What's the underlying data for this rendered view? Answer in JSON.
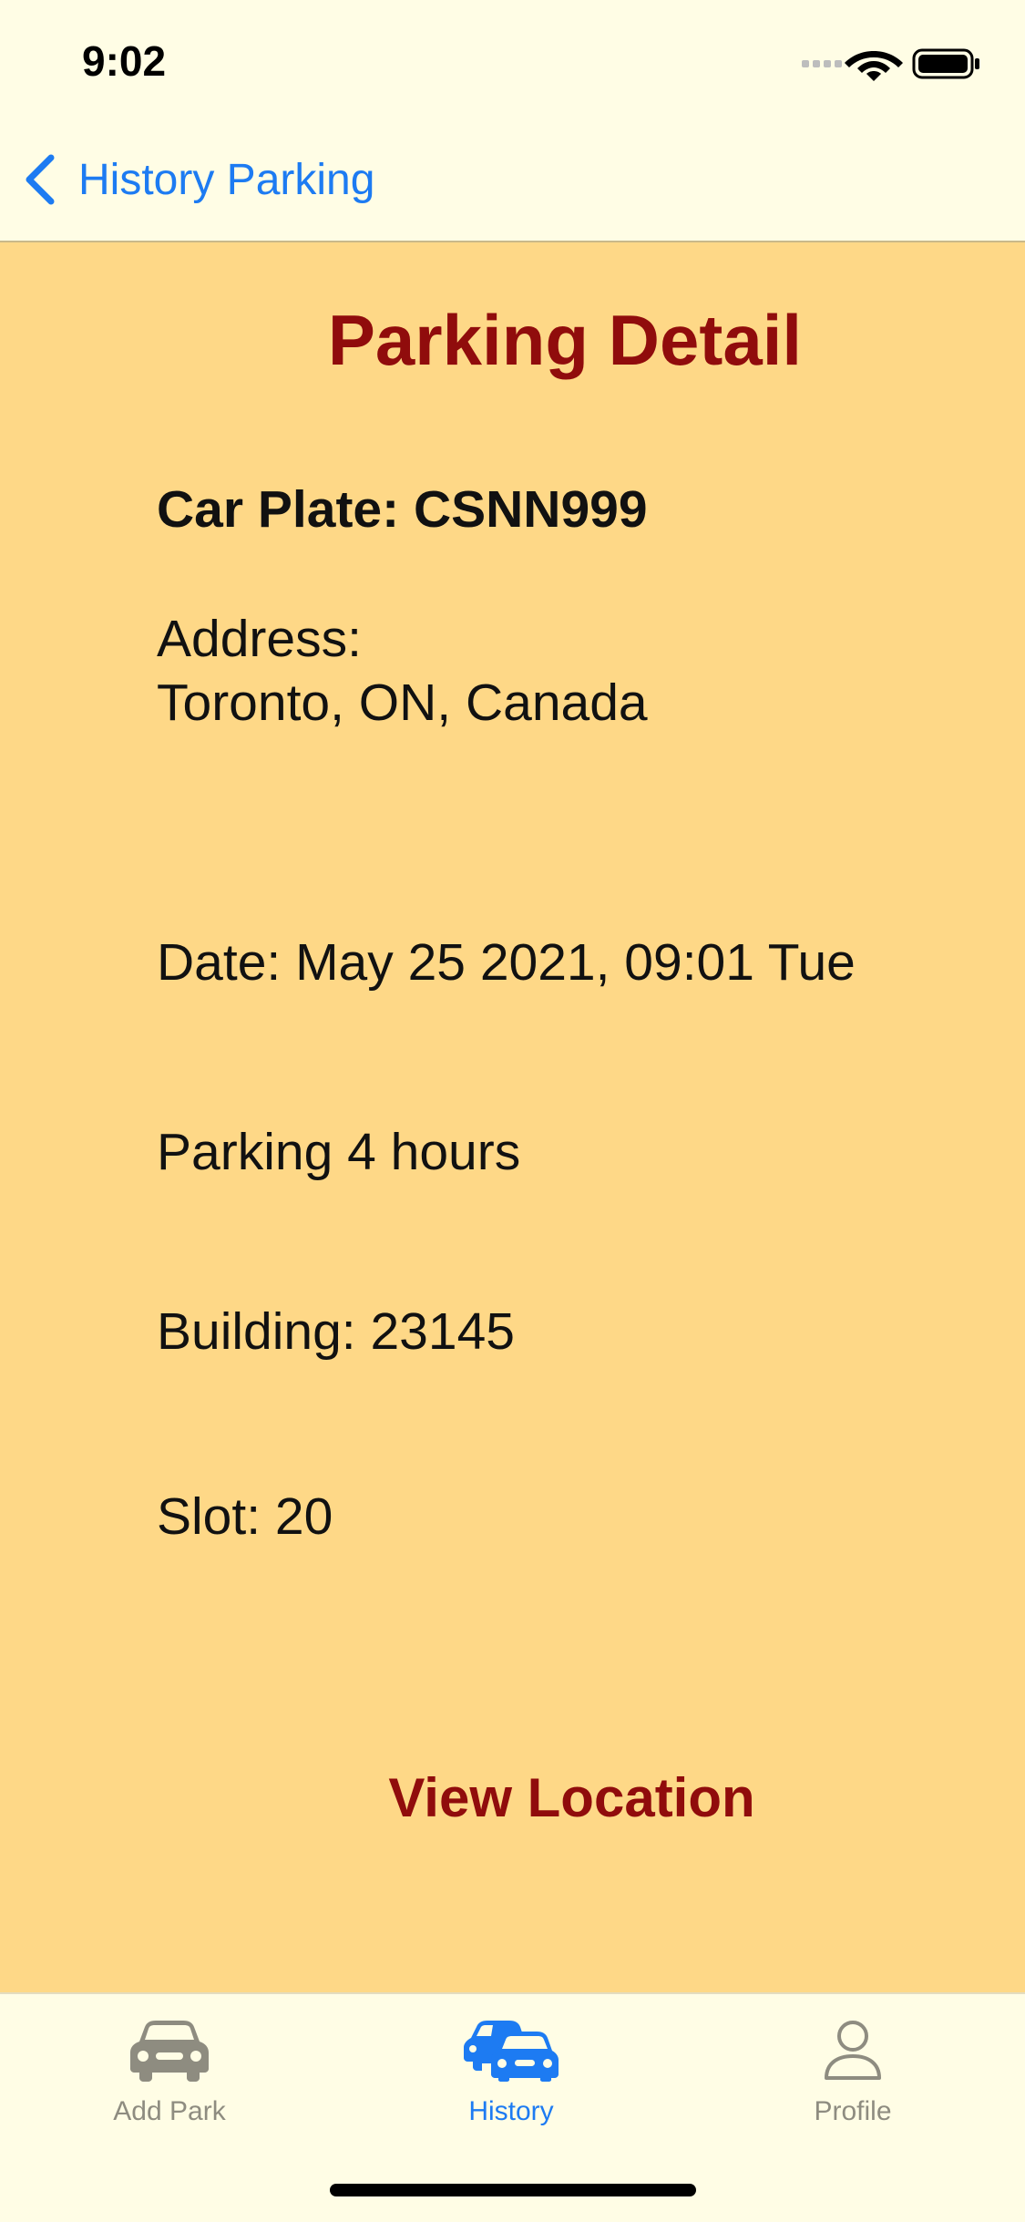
{
  "status_bar": {
    "time": "9:02"
  },
  "nav": {
    "back_label": "History Parking"
  },
  "detail": {
    "title": "Parking Detail",
    "car_plate": "Car Plate: CSNN999",
    "address_label": "Address:",
    "address_value": "Toronto, ON, Canada",
    "date": "Date: May 25 2021, 09:01 Tue",
    "duration": "Parking 4 hours",
    "building": "Building: 23145",
    "slot": "Slot: 20",
    "view_location_label": "View Location"
  },
  "tabs": [
    {
      "label": "Add Park",
      "icon": "car-icon",
      "active": false
    },
    {
      "label": "History",
      "icon": "cars-icon",
      "active": true
    },
    {
      "label": "Profile",
      "icon": "person-icon",
      "active": false
    }
  ],
  "colors": {
    "background": "#FFFDE5",
    "content_background": "#FED887",
    "accent_title": "#900C0C",
    "link_blue": "#1D7BF2",
    "tab_inactive": "#8E8C80"
  }
}
